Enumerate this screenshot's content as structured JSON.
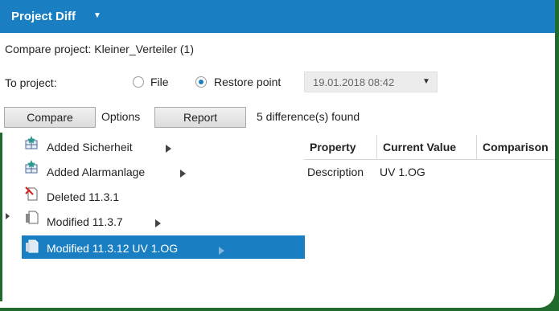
{
  "titlebar": {
    "title": "Project Diff",
    "caret": "▼"
  },
  "compare_project": {
    "label": "Compare project: Kleiner_Verteiler (1)"
  },
  "to_project": {
    "label": "To project:",
    "options": [
      {
        "label": "File",
        "selected": false
      },
      {
        "label": "Restore point",
        "selected": true
      }
    ],
    "restore_point": {
      "value": "19.01.2018 08:42",
      "caret": "▼"
    }
  },
  "toolbar": {
    "compare_label": "Compare",
    "options_label": "Options",
    "report_label": "Report",
    "status": "5 difference(s) found"
  },
  "tree": {
    "items": [
      {
        "label": "Added Sicherheit",
        "icon": "added-icon"
      },
      {
        "label": "Added Alarmanlage",
        "icon": "added-icon"
      },
      {
        "label": "Deleted 11.3.1",
        "icon": "deleted-icon"
      },
      {
        "label": "Modified 11.3.7",
        "icon": "modified-icon"
      },
      {
        "label": "Modified 11.3.12 UV 1.OG",
        "icon": "modified-icon",
        "selected": true
      }
    ]
  },
  "grid": {
    "columns": [
      "Property",
      "Current Value",
      "Comparison"
    ],
    "rows": [
      {
        "property": "Description",
        "current": "UV 1.OG"
      }
    ]
  },
  "colors": {
    "accent": "#1a7fc2",
    "frame": "#1f6a2c"
  }
}
